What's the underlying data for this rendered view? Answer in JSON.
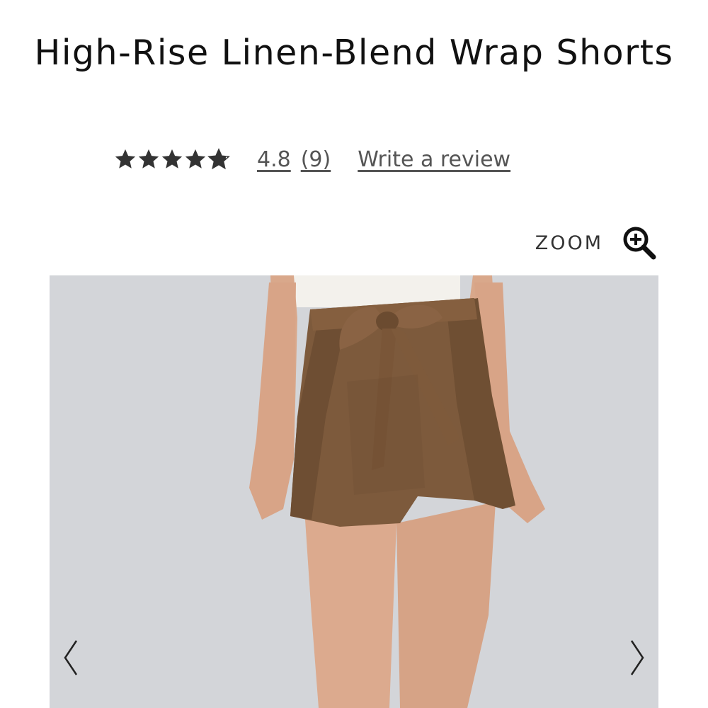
{
  "product": {
    "title": "High-Rise Linen-Blend Wrap Shorts"
  },
  "rating": {
    "stars": 4.8,
    "value": "4.8",
    "count": "(9)",
    "write_review": "Write a review"
  },
  "zoom": {
    "label": "ZOOM",
    "icon": "zoom-in-icon"
  },
  "gallery": {
    "prev_icon": "chevron-left-icon",
    "next_icon": "chevron-right-icon"
  },
  "colors": {
    "shorts": "#7d5a3c",
    "background": "#d3d5d9",
    "skin": "#d9a88b"
  }
}
